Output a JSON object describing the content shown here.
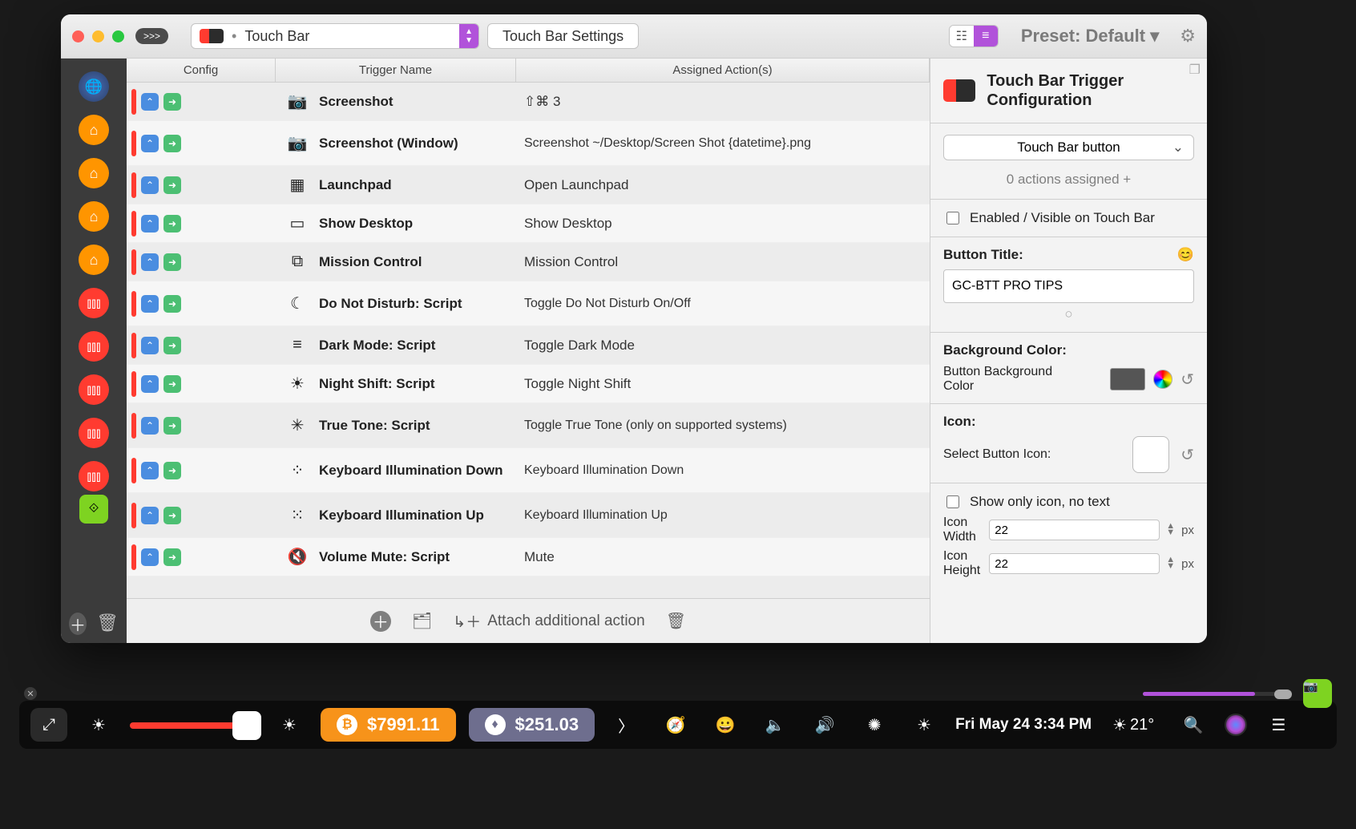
{
  "titlebar": {
    "badge": ">>>",
    "dropdown_label": "Touch Bar",
    "settings_button": "Touch Bar Settings",
    "preset": "Preset: Default ▾"
  },
  "table": {
    "headers": {
      "config": "Config",
      "name": "Trigger Name",
      "action": "Assigned Action(s)"
    },
    "rows": [
      {
        "icon": "📷",
        "name": "Screenshot",
        "action": "⇧⌘ 3"
      },
      {
        "icon": "📷",
        "name": "Screenshot (Window)",
        "action": "Screenshot ~/Desktop/Screen Shot {datetime}.png",
        "tall": true
      },
      {
        "icon": "▦",
        "name": "Launchpad",
        "action": "Open Launchpad"
      },
      {
        "icon": "▭",
        "name": "Show Desktop",
        "action": "Show Desktop"
      },
      {
        "icon": "⧉",
        "name": "Mission Control",
        "action": "Mission Control"
      },
      {
        "icon": "☾",
        "name": "Do Not Disturb: Script",
        "action": "Toggle Do Not Disturb On/Off",
        "tall": true
      },
      {
        "icon": "≡",
        "name": "Dark Mode: Script",
        "action": "Toggle Dark Mode"
      },
      {
        "icon": "☀︎",
        "name": "Night Shift: Script",
        "action": "Toggle Night Shift"
      },
      {
        "icon": "✳︎",
        "name": "True Tone: Script",
        "action": "Toggle True Tone (only on supported systems)",
        "tall": true
      },
      {
        "icon": "⁘",
        "name": "Keyboard Illumination Down",
        "action": "Keyboard Illumination Down",
        "tall": true
      },
      {
        "icon": "⁙",
        "name": "Keyboard Illumination Up",
        "action": "Keyboard Illumination Up",
        "tall": true
      },
      {
        "icon": "🔇",
        "name": "Volume Mute: Script",
        "action": "Mute"
      }
    ],
    "footer_label": "Attach additional action"
  },
  "panel": {
    "title": "Touch Bar Trigger Configuration",
    "type_select": "Touch Bar button",
    "actions_assigned": "0 actions assigned +",
    "enabled_label": "Enabled / Visible on Touch Bar",
    "button_title_label": "Button Title:",
    "button_title_value": "GC-BTT PRO TIPS",
    "bg_label": "Background Color:",
    "bg_sub": "Button Background Color",
    "icon_label": "Icon:",
    "icon_sub": "Select Button Icon:",
    "show_only_icon": "Show only icon, no text",
    "icon_width_label": "Icon Width",
    "icon_width": "22",
    "icon_height_label": "Icon Height",
    "icon_height": "22",
    "unit": "px"
  },
  "touchbar": {
    "btc": "$7991.11",
    "eth": "$251.03",
    "datetime": "Fri May 24 3:34 PM",
    "temp": "21°"
  }
}
